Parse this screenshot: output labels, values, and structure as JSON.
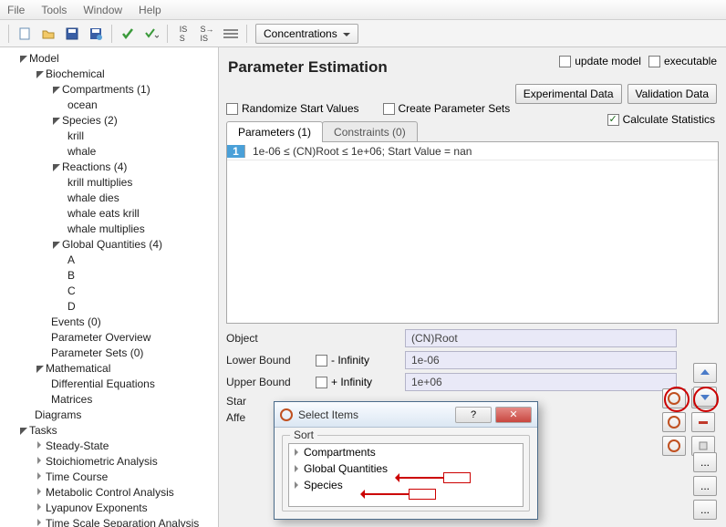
{
  "menu": {
    "file": "File",
    "tools": "Tools",
    "window": "Window",
    "help": "Help"
  },
  "toolbar": {
    "combo": "Concentrations"
  },
  "tree": {
    "model": "Model",
    "biochemical": "Biochemical",
    "compartments": "Compartments (1)",
    "ocean": "ocean",
    "species": "Species (2)",
    "krill": "krill",
    "whale": "whale",
    "reactions": "Reactions (4)",
    "r1": "krill multiplies",
    "r2": "whale dies",
    "r3": "whale eats krill",
    "r4": "whale multiplies",
    "gq": "Global Quantities (4)",
    "gqA": "A",
    "gqB": "B",
    "gqC": "C",
    "gqD": "D",
    "events": "Events (0)",
    "po": "Parameter Overview",
    "ps": "Parameter Sets (0)",
    "math": "Mathematical",
    "de": "Differential Equations",
    "mat": "Matrices",
    "diag": "Diagrams",
    "tasks": "Tasks",
    "t1": "Steady-State",
    "t2": "Stoichiometric Analysis",
    "t3": "Time Course",
    "t4": "Metabolic Control Analysis",
    "t5": "Lyapunov Exponents",
    "t6": "Time Scale Separation Analysis"
  },
  "pe": {
    "title": "Parameter Estimation",
    "update": "update model",
    "executable": "executable",
    "exp": "Experimental Data",
    "val": "Validation Data",
    "rand": "Randomize Start Values",
    "cps": "Create Parameter Sets",
    "calc": "Calculate Statistics",
    "tab1": "Parameters (1)",
    "tab2": "Constraints (0)",
    "row1": "1e-06 ≤ (CN)Root ≤ 1e+06; Start Value = nan",
    "object": "Object",
    "objectval": "(CN)Root",
    "lb": "Lower Bound",
    "lbneg": "- Infinity",
    "lbval": "1e-06",
    "ub": "Upper Bound",
    "ubpos": "+ Infinity",
    "ubval": "1e+06",
    "star": "Star",
    "affe": "Affe"
  },
  "dialog": {
    "title": "Select Items",
    "sort": "Sort",
    "i1": "Compartments",
    "i2": "Global Quantities",
    "i3": "Species"
  }
}
